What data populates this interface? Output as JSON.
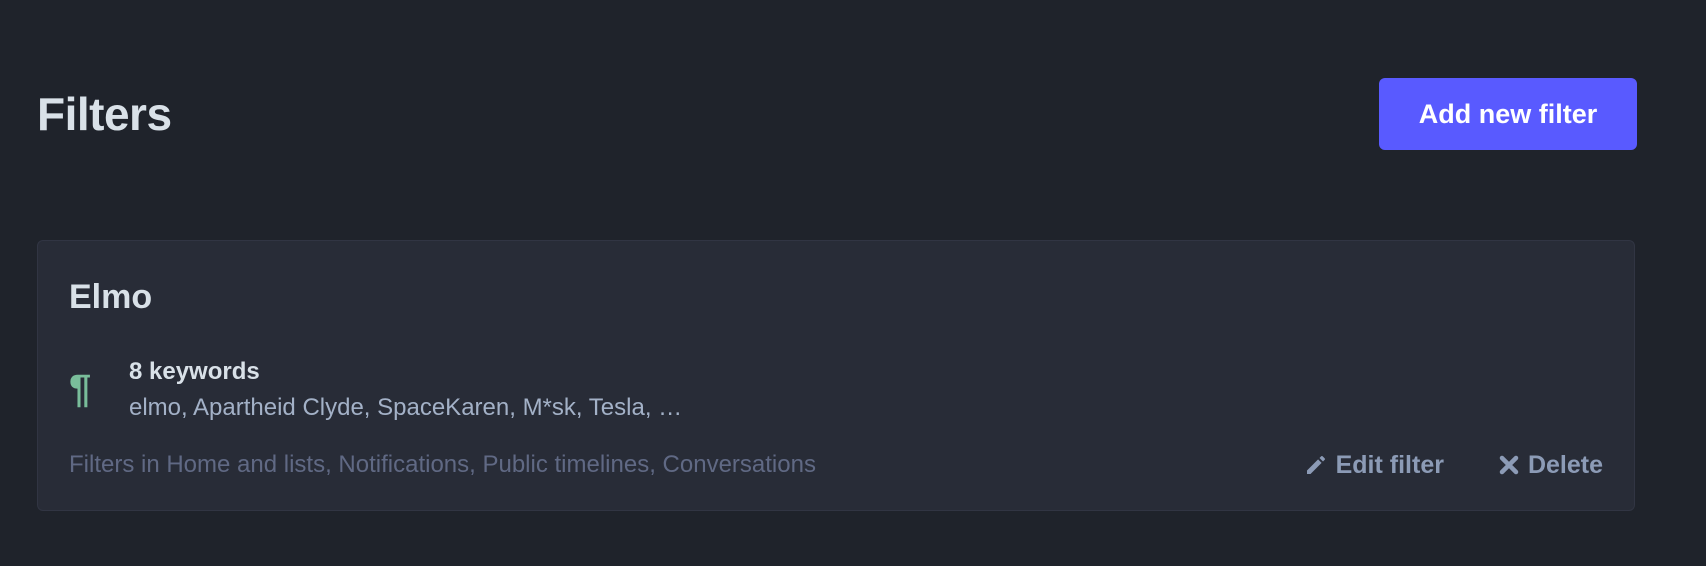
{
  "header": {
    "title": "Filters",
    "add_button_label": "Add new filter"
  },
  "filter": {
    "title": "Elmo",
    "keyword_icon": "pilcrow-icon",
    "keyword_count": "8 keywords",
    "keyword_list": "elmo, Apartheid Clyde, SpaceKaren, M*sk, Tesla, …",
    "contexts": "Filters in Home and lists, Notifications, Public timelines, Conversations",
    "edit_label": "Edit filter",
    "edit_icon": "pencil-icon",
    "delete_label": "Delete",
    "delete_icon": "close-icon"
  },
  "colors": {
    "background": "#1f232b",
    "card": "#282c37",
    "accent": "#595aff",
    "keyword_icon": "#79bd9a"
  }
}
